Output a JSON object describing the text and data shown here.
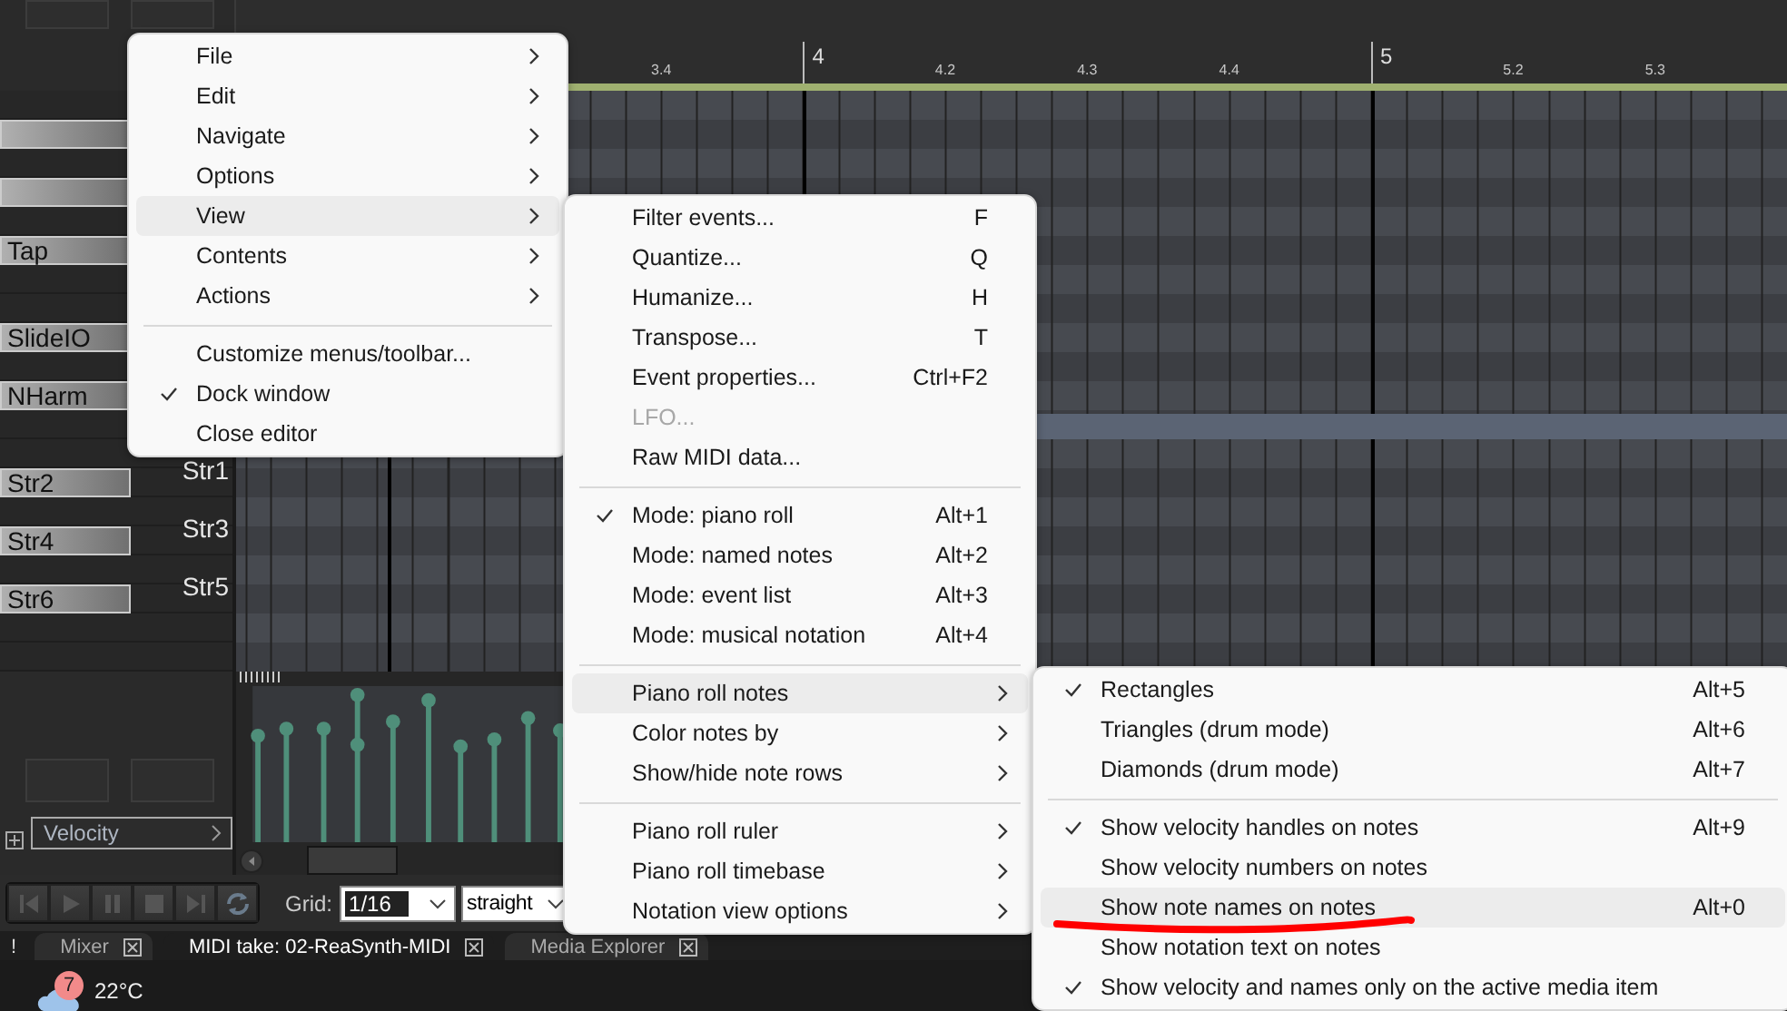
{
  "ruler": {
    "marks": [
      {
        "label": "3.4",
        "kind": "beat"
      },
      {
        "label": "4",
        "kind": "bar"
      },
      {
        "label": "4.2",
        "kind": "beat"
      },
      {
        "label": "4.3",
        "kind": "beat"
      },
      {
        "label": "4.4",
        "kind": "beat"
      },
      {
        "label": "5",
        "kind": "bar"
      },
      {
        "label": "5.2",
        "kind": "beat"
      },
      {
        "label": "5.3",
        "kind": "beat"
      }
    ]
  },
  "piano_keys": [
    {
      "kind": "empty"
    },
    {
      "kind": "bar"
    },
    {
      "kind": "empty"
    },
    {
      "kind": "bar"
    },
    {
      "kind": "empty"
    },
    {
      "kind": "label",
      "label": "Tap"
    },
    {
      "kind": "empty"
    },
    {
      "kind": "empty"
    },
    {
      "kind": "label",
      "label": "SlideIO"
    },
    {
      "kind": "empty"
    },
    {
      "kind": "label",
      "label": "NHarm"
    },
    {
      "kind": "empty"
    },
    {
      "kind": "empty"
    },
    {
      "kind": "label",
      "label": "Str2",
      "name": "Str1"
    },
    {
      "kind": "empty"
    },
    {
      "kind": "label",
      "label": "Str4",
      "name": "Str3"
    },
    {
      "kind": "empty"
    },
    {
      "kind": "label",
      "label": "Str6",
      "name": "Str5"
    },
    {
      "kind": "empty"
    },
    {
      "kind": "empty"
    }
  ],
  "velocity_lane": {
    "dropdown": "Velocity"
  },
  "transport": {
    "grid_label": "Grid:",
    "grid_value": "1/16",
    "swing_value": "straight"
  },
  "tabs": [
    {
      "label": "!",
      "selected": false,
      "closable": false
    },
    {
      "label": "Mixer",
      "selected": false,
      "closable": true
    },
    {
      "label": "MIDI take: 02-ReaSynth-MIDI",
      "selected": true,
      "closable": true
    },
    {
      "label": "Media Explorer",
      "selected": false,
      "closable": true
    }
  ],
  "taskbar": {
    "weather_badge": "7",
    "temperature": "22°C"
  },
  "menus": [
    {
      "items": [
        {
          "label": "File",
          "kind": "submenu",
          "checked": false,
          "selected": false
        },
        {
          "label": "Edit",
          "kind": "submenu",
          "checked": false,
          "selected": false
        },
        {
          "label": "Navigate",
          "kind": "submenu",
          "checked": false,
          "selected": false
        },
        {
          "label": "Options",
          "kind": "submenu",
          "checked": false,
          "selected": false
        },
        {
          "label": "View",
          "kind": "submenu",
          "checked": false,
          "selected": true
        },
        {
          "label": "Contents",
          "kind": "submenu",
          "checked": false,
          "selected": false
        },
        {
          "label": "Actions",
          "kind": "submenu",
          "checked": false,
          "selected": false
        },
        {
          "kind": "separator"
        },
        {
          "label": "Customize menus/toolbar...",
          "kind": "command",
          "checked": false,
          "selected": false
        },
        {
          "label": "Dock window",
          "kind": "command",
          "checked": true,
          "selected": false
        },
        {
          "label": "Close editor",
          "kind": "command",
          "checked": false,
          "selected": false
        }
      ]
    },
    {
      "items": [
        {
          "label": "Filter events...",
          "kind": "command",
          "shortcut": "F",
          "checked": false,
          "selected": false,
          "disabled": false
        },
        {
          "label": "Quantize...",
          "kind": "command",
          "shortcut": "Q",
          "checked": false,
          "selected": false,
          "disabled": false
        },
        {
          "label": "Humanize...",
          "kind": "command",
          "shortcut": "H",
          "checked": false,
          "selected": false,
          "disabled": false
        },
        {
          "label": "Transpose...",
          "kind": "command",
          "shortcut": "T",
          "checked": false,
          "selected": false,
          "disabled": false
        },
        {
          "label": "Event properties...",
          "kind": "command",
          "shortcut": "Ctrl+F2",
          "checked": false,
          "selected": false,
          "disabled": false
        },
        {
          "label": "LFO...",
          "kind": "command",
          "checked": false,
          "selected": false,
          "disabled": true
        },
        {
          "label": "Raw MIDI data...",
          "kind": "command",
          "checked": false,
          "selected": false,
          "disabled": false
        },
        {
          "kind": "separator"
        },
        {
          "label": "Mode: piano roll",
          "kind": "command",
          "shortcut": "Alt+1",
          "checked": true,
          "selected": false,
          "disabled": false
        },
        {
          "label": "Mode: named notes",
          "kind": "command",
          "shortcut": "Alt+2",
          "checked": false,
          "selected": false,
          "disabled": false
        },
        {
          "label": "Mode: event list",
          "kind": "command",
          "shortcut": "Alt+3",
          "checked": false,
          "selected": false,
          "disabled": false
        },
        {
          "label": "Mode: musical notation",
          "kind": "command",
          "shortcut": "Alt+4",
          "checked": false,
          "selected": false,
          "disabled": false
        },
        {
          "kind": "separator"
        },
        {
          "label": "Piano roll notes",
          "kind": "submenu",
          "checked": false,
          "selected": true,
          "disabled": false
        },
        {
          "label": "Color notes by",
          "kind": "submenu",
          "checked": false,
          "selected": false,
          "disabled": false
        },
        {
          "label": "Show/hide note rows",
          "kind": "submenu",
          "checked": false,
          "selected": false,
          "disabled": false
        },
        {
          "kind": "separator"
        },
        {
          "label": "Piano roll ruler",
          "kind": "submenu",
          "checked": false,
          "selected": false,
          "disabled": false
        },
        {
          "label": "Piano roll timebase",
          "kind": "submenu",
          "checked": false,
          "selected": false,
          "disabled": false
        },
        {
          "label": "Notation view options",
          "kind": "submenu",
          "checked": false,
          "selected": false,
          "disabled": false
        }
      ]
    },
    {
      "items": [
        {
          "label": "Rectangles",
          "kind": "command",
          "shortcut": "Alt+5",
          "checked": true,
          "selected": false
        },
        {
          "label": "Triangles (drum mode)",
          "kind": "command",
          "shortcut": "Alt+6",
          "checked": false,
          "selected": false
        },
        {
          "label": "Diamonds (drum mode)",
          "kind": "command",
          "shortcut": "Alt+7",
          "checked": false,
          "selected": false
        },
        {
          "kind": "separator"
        },
        {
          "label": "Show velocity handles on notes",
          "kind": "command",
          "shortcut": "Alt+9",
          "checked": true,
          "selected": false
        },
        {
          "label": "Show velocity numbers on notes",
          "kind": "command",
          "checked": false,
          "selected": false
        },
        {
          "label": "Show note names on notes",
          "kind": "command",
          "shortcut": "Alt+0",
          "checked": false,
          "selected": true
        },
        {
          "label": "Show notation text on notes",
          "kind": "command",
          "checked": false,
          "selected": false
        },
        {
          "label": "Show velocity and names only on the active media item",
          "kind": "command",
          "checked": true,
          "selected": false
        }
      ]
    }
  ]
}
